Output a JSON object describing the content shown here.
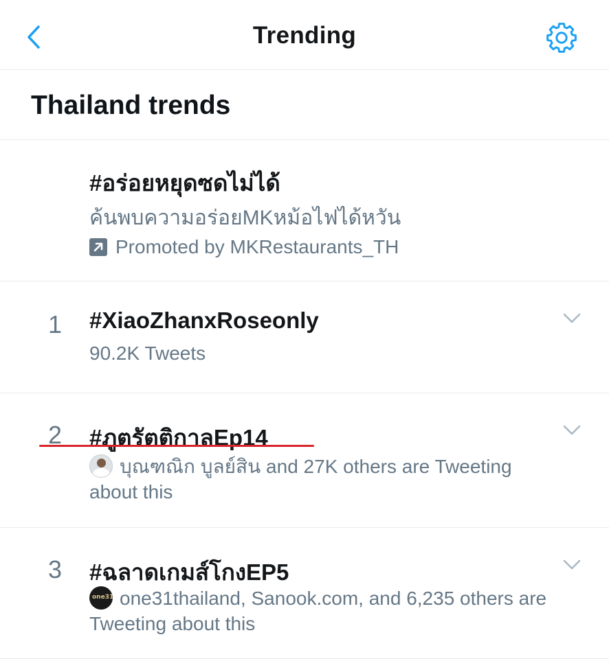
{
  "header": {
    "title": "Trending",
    "back_icon": "chevron-left-icon",
    "settings_icon": "gear-icon"
  },
  "section": {
    "title": "Thailand trends"
  },
  "promoted": {
    "name": "#อร่อยหยุดซดไม่ได้",
    "description": "ค้นพบความอร่อยMKหม้อไฟได้หวัน",
    "promoted_by": "Promoted by MKRestaurants_TH",
    "icon": "promoted-arrow-icon"
  },
  "trends": [
    {
      "rank": "1",
      "name": "#XiaoZhanxRoseonly",
      "meta": "90.2K Tweets"
    },
    {
      "rank": "2",
      "name": "#ภูตรัตติกาลEp14",
      "meta": "บุณฑณิก บูลย์สิน and 27K others are Tweeting about this",
      "avatar": "user-avatar"
    },
    {
      "rank": "3",
      "name": "#ฉลาดเกมส์โกงEP5",
      "meta": "one31thailand, Sanook.com, and 6,235 others are Tweeting about this",
      "avatar": "channel-avatar"
    }
  ],
  "colors": {
    "accent": "#1da1f2",
    "text_primary": "#14171a",
    "text_secondary": "#657786",
    "divider": "#e6ecf0",
    "annotation_red": "#d8232a"
  }
}
